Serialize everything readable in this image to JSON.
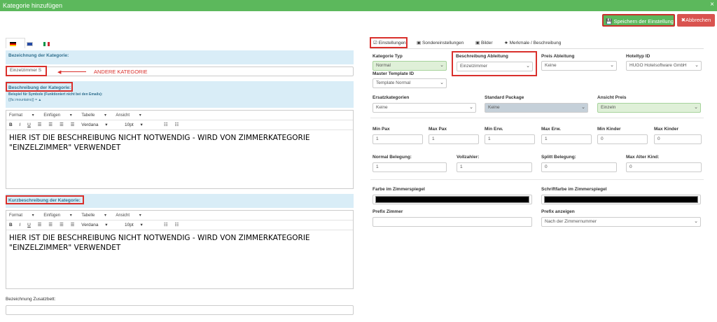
{
  "window": {
    "title": "Kategorie hinzufügen",
    "close": "×"
  },
  "toolbar": {
    "save_label": "Speichern der Einstellung",
    "cancel_label": "Abbrechen"
  },
  "left": {
    "name_header": "Bezeichnung der Kategorie:",
    "name_value": "Einzelzimmer S",
    "annotation": "ANDERE KATEGORIE",
    "desc_header": "Beschreibung der Kategorie:",
    "desc_hint1": "Beispiel für Symbole (Funktioniert nicht bei den Emails):",
    "desc_hint2": "{{fa::mountains}} = ▲",
    "editor_menu": [
      "Format",
      "Einfügen",
      "Tabelle",
      "Ansicht"
    ],
    "editor_font": "Verdana",
    "editor_size": "10pt",
    "desc_text": "HIER IST DIE BESCHREIBUNG NICHT NOTWENDIG -  WIRD VON ZIMMERKATEGORIE \"EINZELZIMMER\" VERWENDET",
    "short_header": "Kurzbeschreibung der Kategorie:",
    "short_text": "HIER IST DIE BESCHREIBUNG NICHT NOTWENDIG - WIRD VON ZIMMERKATEGORIE \"EINZELZIMMER\" VERWENDET",
    "extra_bed_label": "Bezeichnung Zusatzbett:"
  },
  "tabs": [
    "Einstellungen",
    "Sondereinstellungen",
    "Bilder",
    "Merkmale / Beschreibung"
  ],
  "right": {
    "kategorie_typ_label": "Kategorie Typ",
    "kategorie_typ_value": "Normal",
    "beschreibung_ableitung_label": "Beschreibung Ableitung",
    "beschreibung_ableitung_value": "Einzelzimmer",
    "preis_ableitung_label": "Preis Ableitung",
    "preis_ableitung_value": "Keine",
    "hoteltyp_label": "Hoteltyp ID",
    "hoteltyp_value": "HUGO Hotelsoftware GmbH",
    "master_template_label": "Master Template ID",
    "master_template_value": "Template Normal",
    "ersatz_label": "Ersatzkategorien",
    "ersatz_value": "Keine",
    "standard_package_label": "Standard Package",
    "standard_package_value": "Keine",
    "ansicht_preis_label": "Ansicht Preis",
    "ansicht_preis_value": "Einzeln",
    "min_pax_label": "Min Pax",
    "min_pax": "1",
    "max_pax_label": "Max Pax",
    "max_pax": "1",
    "min_erw_label": "Min Erw.",
    "min_erw": "1",
    "max_erw_label": "Max Erw.",
    "max_erw": "1",
    "min_kinder_label": "Min Kinder",
    "min_kinder": "0",
    "max_kinder_label": "Max Kinder",
    "max_kinder": "0",
    "normal_belegung_label": "Normal Belegung:",
    "normal_belegung": "1",
    "vollzahler_label": "Vollzahler:",
    "vollzahler": "1",
    "splitt_label": "Splitt Belegung:",
    "splitt": "0",
    "max_alter_label": "Max Alter Kind:",
    "max_alter": "0",
    "farbe_label": "Farbe im Zimmerspiegel",
    "schriftfarbe_label": "Schriftfarbe im Zimmerspiegel",
    "prefix_zimmer_label": "Prefix Zimmer",
    "prefix_zimmer": "",
    "prefix_anzeigen_label": "Prefix anzeigen",
    "prefix_anzeigen_value": "Nach der Zimmernummer"
  },
  "colors": {
    "title_green": "#5cb85c",
    "danger": "#d9534f",
    "highlight": "#d9302c",
    "info_bg": "#d9edf7"
  }
}
